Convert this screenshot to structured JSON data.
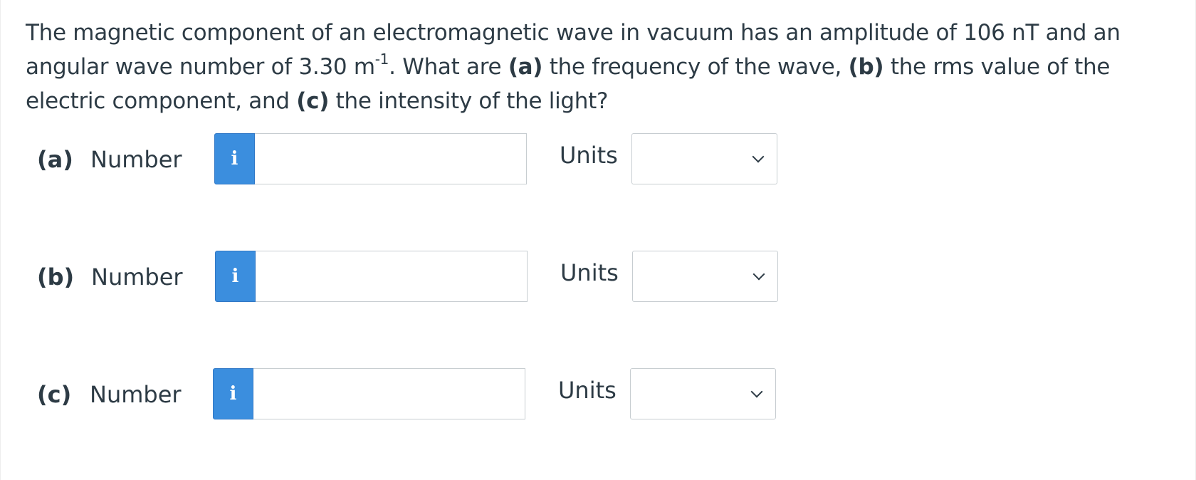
{
  "question": {
    "text_1": "The magnetic component of an electromagnetic wave in vacuum has an amplitude of 106 nT and an angular wave number of 3.30 m",
    "superscript": "-1",
    "text_2": ". What are ",
    "part_a_marker": "(a)",
    "text_3": " the frequency of the wave, ",
    "part_b_marker": "(b)",
    "text_4": " the rms value of the electric component, and ",
    "part_c_marker": "(c)",
    "text_5": " the intensity of the light?"
  },
  "parts": [
    {
      "label": "(a)",
      "number_label": "Number",
      "info_icon": "i",
      "value": "",
      "units_label": "Units",
      "units_selected": ""
    },
    {
      "label": "(b)",
      "number_label": "Number",
      "info_icon": "i",
      "value": "",
      "units_label": "Units",
      "units_selected": ""
    },
    {
      "label": "(c)",
      "number_label": "Number",
      "info_icon": "i",
      "value": "",
      "units_label": "Units",
      "units_selected": ""
    }
  ],
  "icons": {
    "info": "info-icon",
    "dropdown": "chevron-down-icon"
  },
  "colors": {
    "info_button": "#3b8ede",
    "text": "#2d3b45",
    "border": "#c7cdd1"
  }
}
